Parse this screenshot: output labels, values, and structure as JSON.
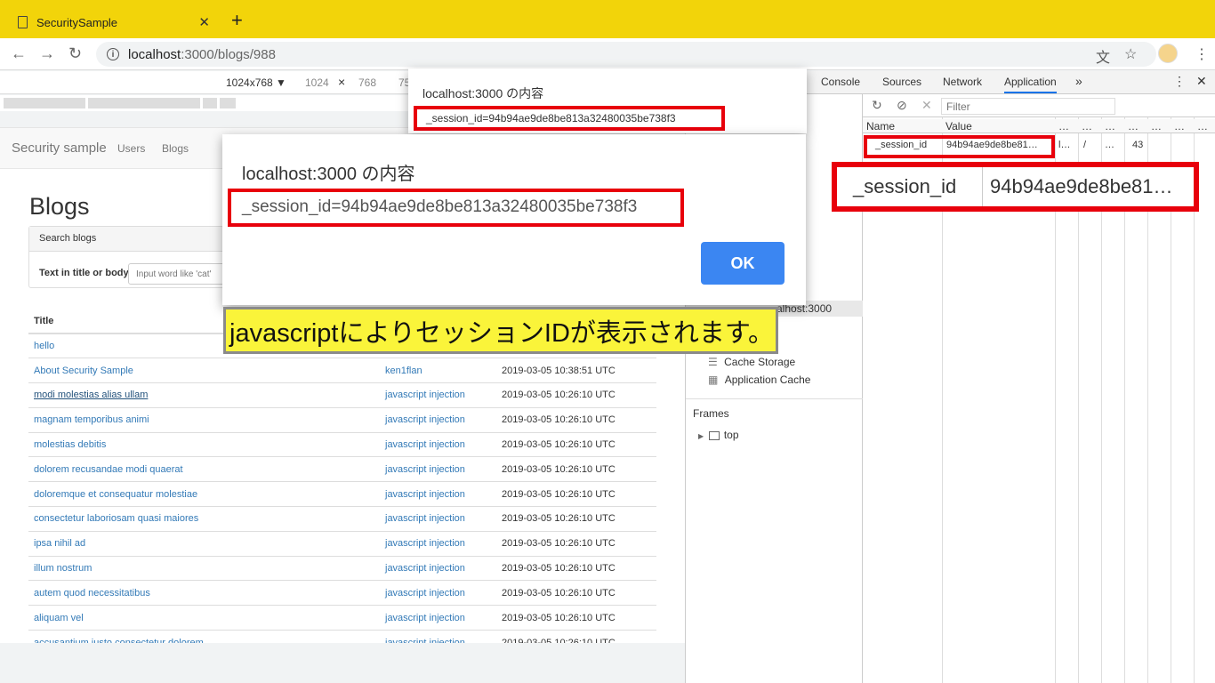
{
  "browser": {
    "tab_title": "SecuritySample",
    "tab_close": "✕",
    "new_tab": "+",
    "url_host": "localhost",
    "url_path": ":3000/blogs/988",
    "back": "←",
    "forward": "→",
    "reload": "↻",
    "translate": "⽂",
    "star": "☆",
    "menu": "⋮"
  },
  "device_toolbar": {
    "preset": "1024x768 ▼",
    "width": "1024",
    "times": "×",
    "height": "768",
    "zoom": "75"
  },
  "site": {
    "brand": "Security sample",
    "nav_users": "Users",
    "nav_blogs": "Blogs",
    "heading": "Blogs",
    "search_panel_title": "Search blogs",
    "search_label": "Text in title or body",
    "search_placeholder": "Input word like 'cat'",
    "table_header_title": "Title",
    "rows": [
      {
        "title": "hello",
        "author": "",
        "date": ""
      },
      {
        "title": "About Security Sample",
        "author": "ken1flan",
        "date": "2019-03-05 10:38:51 UTC"
      },
      {
        "title": "modi molestias alias ullam",
        "author": "javascript injection",
        "date": "2019-03-05 10:26:10 UTC"
      },
      {
        "title": "magnam temporibus animi",
        "author": "javascript injection",
        "date": "2019-03-05 10:26:10 UTC"
      },
      {
        "title": "molestias debitis",
        "author": "javascript injection",
        "date": "2019-03-05 10:26:10 UTC"
      },
      {
        "title": "dolorem recusandae modi quaerat",
        "author": "javascript injection",
        "date": "2019-03-05 10:26:10 UTC"
      },
      {
        "title": "doloremque et consequatur molestiae",
        "author": "javascript injection",
        "date": "2019-03-05 10:26:10 UTC"
      },
      {
        "title": "consectetur laboriosam quasi maiores",
        "author": "javascript injection",
        "date": "2019-03-05 10:26:10 UTC"
      },
      {
        "title": "ipsa nihil ad",
        "author": "javascript injection",
        "date": "2019-03-05 10:26:10 UTC"
      },
      {
        "title": "illum nostrum",
        "author": "javascript injection",
        "date": "2019-03-05 10:26:10 UTC"
      },
      {
        "title": "autem quod necessitatibus",
        "author": "javascript injection",
        "date": "2019-03-05 10:26:10 UTC"
      },
      {
        "title": "aliquam vel",
        "author": "javascript injection",
        "date": "2019-03-05 10:26:10 UTC"
      },
      {
        "title": "accusantium iusto consectetur dolorem",
        "author": "javascript injection",
        "date": "2019-03-05 10:26:10 UTC"
      }
    ]
  },
  "devtools": {
    "tabs": [
      "Console",
      "Sources",
      "Network",
      "Application"
    ],
    "more": "»",
    "menu": "⋮",
    "close": "✕",
    "filter_placeholder": "Filter",
    "cookie_columns": [
      "Name",
      "Value",
      "…",
      "…",
      "…",
      "…",
      "…",
      "…",
      "…"
    ],
    "cookie_row": {
      "name": "_session_id",
      "value": "94b94ae9de8be81…",
      "domain": "l…",
      "path": "/",
      "expires": "…",
      "size": "43"
    },
    "sidebar_origin": "alhost:3000",
    "cache_storage": "Cache Storage",
    "application_cache": "Application Cache",
    "frames": "Frames",
    "frame_top": "top"
  },
  "dialog_small": {
    "title": "localhost:3000 の内容",
    "message": "_session_id=94b94ae9de8be813a32480035be738f3"
  },
  "dialog_big": {
    "title": "localhost:3000 の内容",
    "message": "_session_id=94b94ae9de8be813a32480035be738f3",
    "ok": "OK"
  },
  "callout": "javascriptによりセッションIDが表示されます。",
  "zoom_box": {
    "name": "_session_id",
    "value": "94b94ae9de8be81…"
  },
  "colors": {
    "tabstrip": "#f2d40a",
    "highlight": "#e8000b",
    "callout_bg": "#faf43a",
    "ok_button": "#3b86f2",
    "link": "#337ab7"
  }
}
